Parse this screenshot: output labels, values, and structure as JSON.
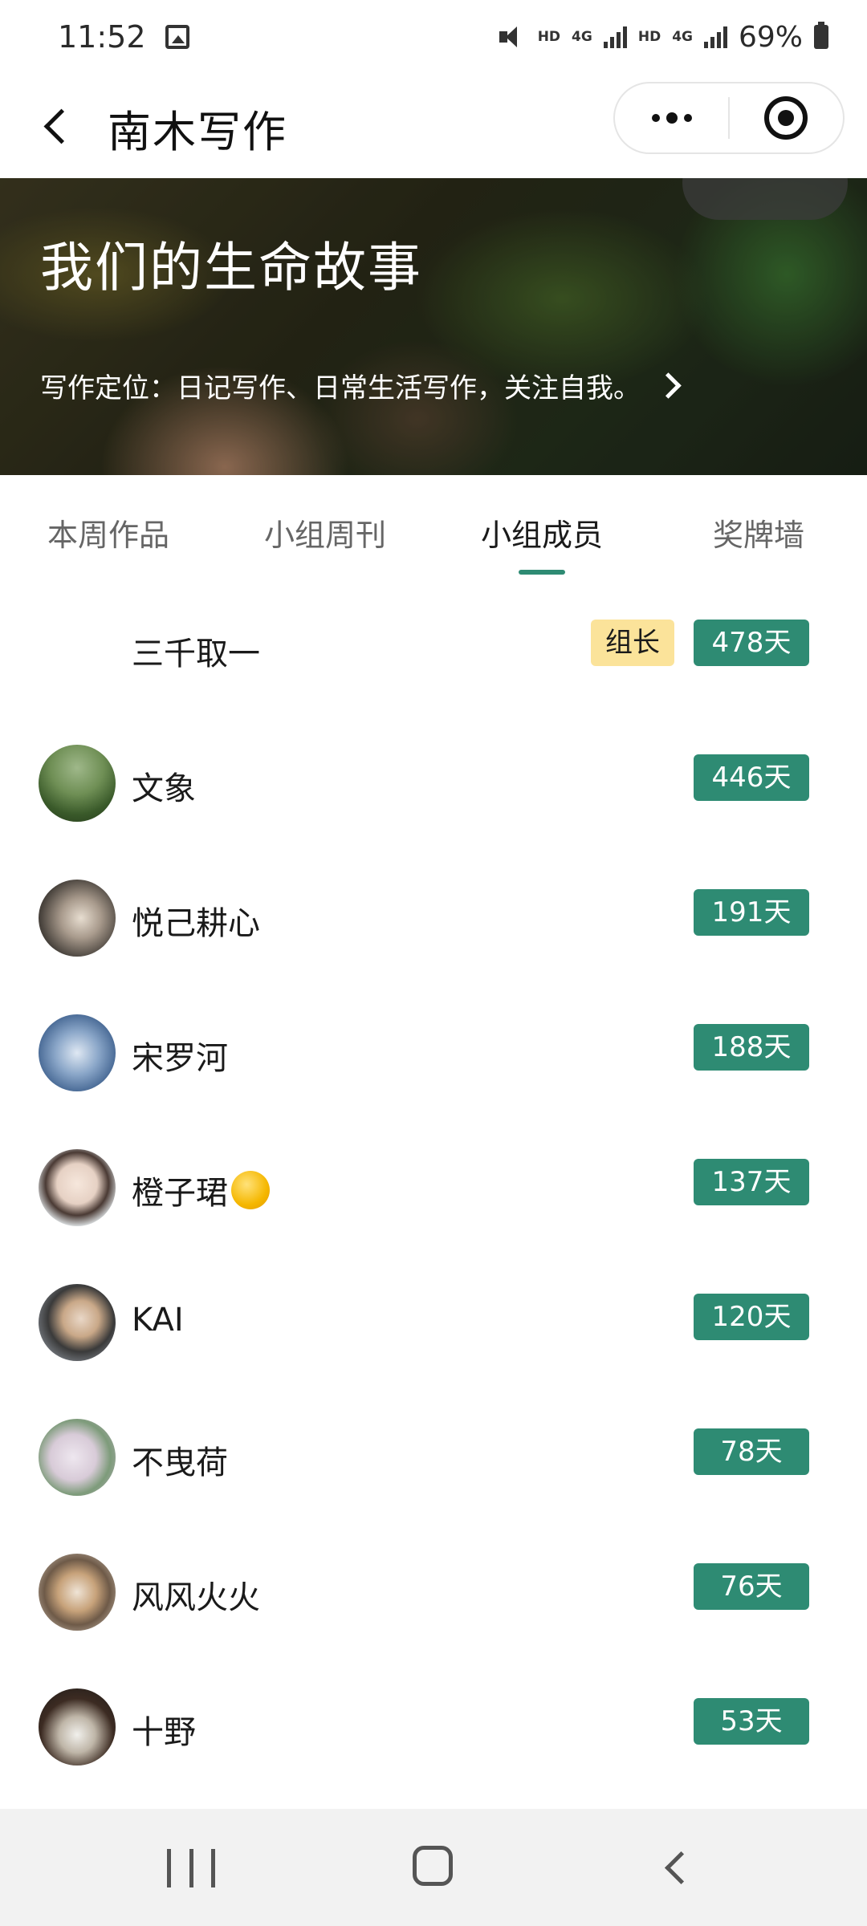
{
  "status_bar": {
    "time": "11:52",
    "hd_1": "HD",
    "net_1": "4G",
    "hd_2": "HD",
    "net_2": "4G",
    "battery": "69%"
  },
  "nav": {
    "title": "南木写作"
  },
  "banner": {
    "title": "我们的生命故事",
    "description": "写作定位：日记写作、日常生活写作，关注自我。"
  },
  "tabs": [
    {
      "label": "本周作品",
      "active": false
    },
    {
      "label": "小组周刊",
      "active": false
    },
    {
      "label": "小组成员",
      "active": true
    },
    {
      "label": "奖牌墙",
      "active": false
    }
  ],
  "members": [
    {
      "name": "三千取一",
      "role": "组长",
      "days": "478天"
    },
    {
      "name": "文象",
      "days": "446天"
    },
    {
      "name": "悦己耕心",
      "days": "191天"
    },
    {
      "name": "宋罗河",
      "days": "188天"
    },
    {
      "name": "橙子珺",
      "days": "137天"
    },
    {
      "name": "KAI",
      "days": "120天"
    },
    {
      "name": "不曳荷",
      "days": "78天"
    },
    {
      "name": "风风火火",
      "days": "76天"
    },
    {
      "name": "十野",
      "days": "53天"
    }
  ],
  "colors": {
    "accent": "#2e8b73",
    "leader_badge": "#fbe39a"
  },
  "icons": {
    "back": "chevron-left-icon",
    "more": "more-dots-icon",
    "close": "target-close-icon",
    "banner_arrow": "chevron-right-icon"
  }
}
